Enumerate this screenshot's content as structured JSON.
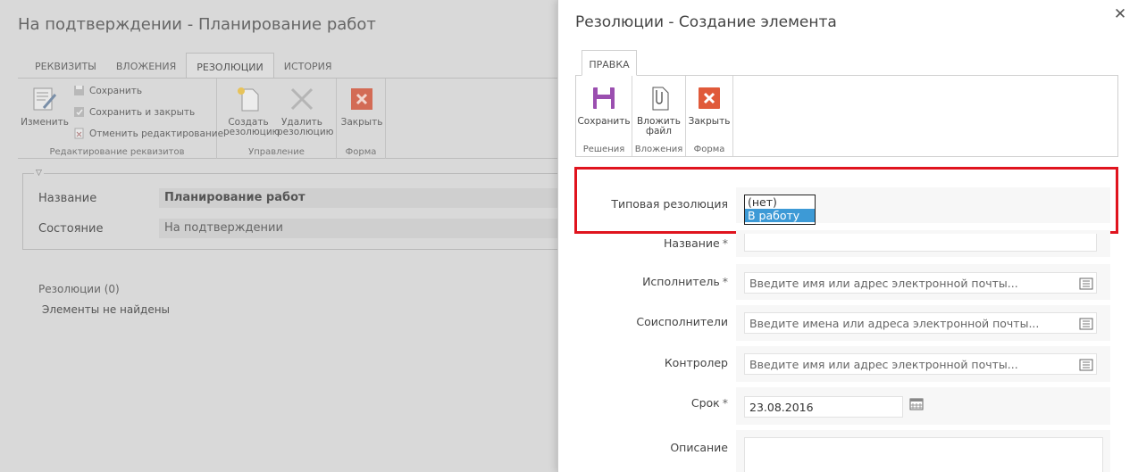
{
  "background": {
    "title": "На подтверждении - Планирование работ",
    "tabs": [
      {
        "label": "РЕКВИЗИТЫ"
      },
      {
        "label": "ВЛОЖЕНИЯ"
      },
      {
        "label": "РЕЗОЛЮЦИИ",
        "active": true
      },
      {
        "label": "ИСТОРИЯ"
      }
    ],
    "ribbon": {
      "edit_label": "Изменить",
      "save_label": "Сохранить",
      "save_close_label": "Сохранить и закрыть",
      "cancel_edit_label": "Отменить редактирование",
      "group_edit_label": "Редактирование реквизитов",
      "create_label": "Создать резолюцию",
      "create_line1": "Создать",
      "create_line2": "резолюцию",
      "delete_line1": "Удалить",
      "delete_line2": "резолюцию",
      "group_manage_label": "Управление",
      "close_label": "Закрыть",
      "group_form_label": "Форма"
    },
    "fields": {
      "name_label": "Название",
      "name_value": "Планирование работ",
      "state_label": "Состояние",
      "state_value": "На подтверждении"
    },
    "resolutions_title": "Резолюции (0)",
    "resolutions_empty": "Элементы не найдены"
  },
  "dialog": {
    "title": "Резолюции - Создание элемента",
    "close_icon": "close-icon",
    "ribbon_tab": "ПРАВКА",
    "ribbon": {
      "save_label": "Сохранить",
      "group_solutions": "Решения",
      "attach_line1": "Вложить",
      "attach_line2": "файл",
      "group_attachments": "Вложения",
      "close_label": "Закрыть",
      "group_form": "Форма"
    },
    "form": {
      "typical_label": "Типовая резолюция",
      "typical_options": [
        "(нет)",
        "В работу"
      ],
      "typical_selected_index": 1,
      "name_label": "Название",
      "name_value": "",
      "executor_label": "Исполнитель",
      "executor_placeholder": "Введите имя или адрес электронной почты...",
      "coexecutors_label": "Соисполнители",
      "coexecutors_placeholder": "Введите имена или адреса электронной почты...",
      "controller_label": "Контролер",
      "controller_placeholder": "Введите имя или адрес электронной почты...",
      "deadline_label": "Срок",
      "deadline_value": "23.08.2016",
      "description_label": "Описание",
      "required_mark": "*"
    }
  },
  "colors": {
    "highlight": "#e0141e",
    "selection": "#3d9ad6",
    "save_icon": "#9b59b6",
    "close_icon": "#e05a3a"
  }
}
